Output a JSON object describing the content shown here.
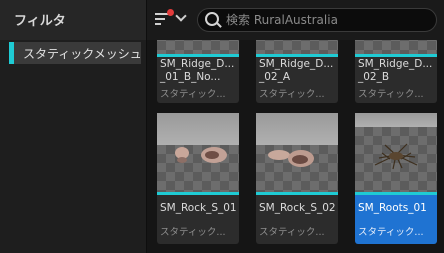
{
  "sidebar": {
    "title": "フィルタ",
    "items": [
      {
        "label": "スタティックメッシュ"
      }
    ]
  },
  "toolbar": {
    "search_placeholder": "検索 RuralAustralia"
  },
  "assets": [
    {
      "name_line1": "SM_Ridge_D...",
      "name_line2": "_01_B_No...",
      "type": "スタティック..."
    },
    {
      "name_line1": "SM_Ridge_D...",
      "name_line2": "_02_A",
      "type": "スタティック..."
    },
    {
      "name_line1": "SM_Ridge_D...",
      "name_line2": "_02_B",
      "type": "スタティック..."
    },
    {
      "name": "SM_Rock_S_01",
      "type": "スタティック..."
    },
    {
      "name": "SM_Rock_S_02",
      "type": "スタティック..."
    },
    {
      "name": "SM_Roots_01",
      "type": "スタティック...",
      "selected": true
    }
  ],
  "colors": {
    "accent": "#1fcbd4",
    "selection": "#1f73d2",
    "notification": "#e23b3b"
  }
}
